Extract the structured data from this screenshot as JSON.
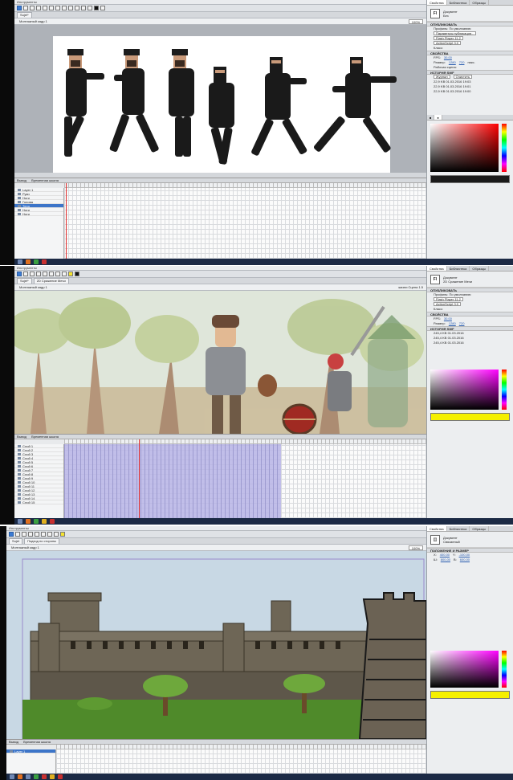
{
  "panel1": {
    "topbar": "Инструменты",
    "tabs": [
      "Sujet*"
    ],
    "scene": "Монтажный кадр 1",
    "zoom": "100%",
    "timeline_tabs": [
      "Вывод",
      "Временная шкала"
    ],
    "layers": [
      "Layer 1",
      "Руки",
      "Ноги",
      "Голова",
      "Тело",
      "Ноги",
      "Ноги"
    ],
    "right_tabs": [
      "Свойства",
      "Библиотека",
      "Образцы"
    ],
    "doc_label": "Документ",
    "doc_name": "Без",
    "sections": {
      "publish": "ОПУБЛИКОВАТЬ",
      "properties": "СВОЙСТВА",
      "history": "ИСТОРИЯ SWF"
    },
    "rows": {
      "profile": "Профиль: По умолчанию",
      "settings": "Параметры публикации...",
      "player": "Flash Player 11.2",
      "script": "ActionScript 3.0",
      "class": "Класс:",
      "fps_label": "FPS:",
      "fps": "30,00",
      "size_label": "Размер:",
      "w": "1280",
      "h": "720",
      "unit": "пикс.",
      "stage": "Рабочая сцена:",
      "log": "Журнал",
      "clear": "Очистить",
      "history": [
        "22,9 KB  01.03.2016  19:03",
        "22,9 KB  01.03.2016  19:01",
        "22,9 KB  01.03.2016  19:00"
      ]
    }
  },
  "panel2": {
    "topbar": "Инструменты",
    "tabs": [
      "Sujet*",
      "2D Сражение Мечи"
    ],
    "scene": "Монтажный кадр 1",
    "breadcrumb": "жизни Сцена 1.5",
    "timeline_tabs": [
      "Вывод",
      "Временная шкала"
    ],
    "layers": [
      "Слой 1",
      "Слой 2",
      "Слой 3",
      "Слой 4",
      "Слой 5",
      "Слой 6",
      "Слой 7",
      "Слой 8",
      "Слой 9",
      "Слой 10",
      "Слой 11",
      "Слой 12",
      "Слой 13",
      "Слой 14",
      "Слой 15"
    ],
    "right_tabs": [
      "Свойства",
      "Библиотека",
      "Образцы"
    ],
    "doc_label": "Документ",
    "doc_name": "2D Сражение Мечи",
    "fps": "30,00",
    "w": "1280",
    "h": "720",
    "history": [
      "245,4 KB  01.03.2016",
      "245,4 KB  01.03.2016",
      "245,4 KB  01.03.2016"
    ]
  },
  "panel3": {
    "topbar": "Инструменты",
    "tabs": [
      "Sujet",
      "Подход по стороны"
    ],
    "scene": "Монтажный кадр 1",
    "zoom": "100%",
    "timeline_tabs": [
      "Вывод",
      "Временная шкала"
    ],
    "layers": [
      "Layer 1"
    ],
    "right_tabs": [
      "Свойства",
      "Библиотека",
      "Образцы"
    ],
    "doc_label": "Документ",
    "doc_name": "Связанный",
    "sections": {
      "pos": "ПОЛОЖЕНИЕ И РАЗМЕР"
    },
    "x": "400,00",
    "y": "-100,00",
    "w": "800,00",
    "h": "600,00"
  },
  "colors": {
    "stage_bg": "#ffffff",
    "sky": "#c8d8e4",
    "stone": "#6e6656",
    "forest": "#c9b79b",
    "selection": "#3c75c9",
    "keyframe_fill": "#b7b4e6"
  }
}
